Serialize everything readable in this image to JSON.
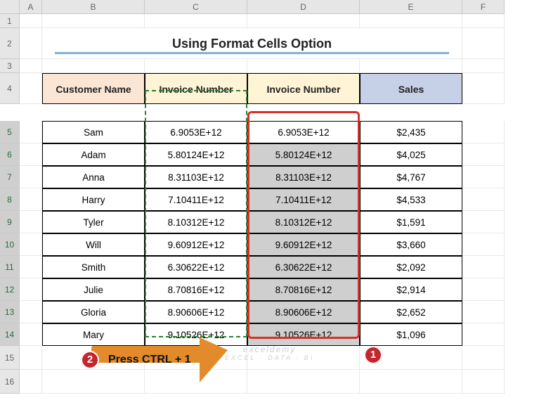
{
  "columns": [
    "A",
    "B",
    "C",
    "D",
    "E",
    "F"
  ],
  "rows": [
    "1",
    "2",
    "3",
    "4",
    "5",
    "6",
    "7",
    "8",
    "9",
    "10",
    "11",
    "12",
    "13",
    "14",
    "15",
    "16"
  ],
  "title": "Using Format Cells Option",
  "headers": {
    "b": "Customer Name",
    "c": "Invoice Number",
    "d": "Invoice Number",
    "e": "Sales"
  },
  "data": [
    {
      "name": "Sam",
      "c": "6.9053E+12",
      "d": "6.9053E+12",
      "sales": "$2,435"
    },
    {
      "name": "Adam",
      "c": "5.80124E+12",
      "d": "5.80124E+12",
      "sales": "$4,025"
    },
    {
      "name": "Anna",
      "c": "8.31103E+12",
      "d": "8.31103E+12",
      "sales": "$4,767"
    },
    {
      "name": "Harry",
      "c": "7.10411E+12",
      "d": "7.10411E+12",
      "sales": "$4,533"
    },
    {
      "name": "Tyler",
      "c": "8.10312E+12",
      "d": "8.10312E+12",
      "sales": "$1,591"
    },
    {
      "name": "Will",
      "c": "9.60912E+12",
      "d": "9.60912E+12",
      "sales": "$3,660"
    },
    {
      "name": "Smith",
      "c": "6.30622E+12",
      "d": "6.30622E+12",
      "sales": "$2,092"
    },
    {
      "name": "Julie",
      "c": "8.70816E+12",
      "d": "8.70816E+12",
      "sales": "$2,914"
    },
    {
      "name": "Gloria",
      "c": "8.90606E+12",
      "d": "8.90606E+12",
      "sales": "$2,652"
    },
    {
      "name": "Mary",
      "c": "9.10526E+12",
      "d": "9.10526E+12",
      "sales": "$1,096"
    }
  ],
  "callout": {
    "text": "Press CTRL + 1",
    "badge1": "1",
    "badge2": "2"
  },
  "watermark": {
    "line1": "exceldemy",
    "line2": "EXCEL · DATA · BI"
  },
  "chart_data": {
    "type": "table",
    "title": "Using Format Cells Option",
    "columns": [
      "Customer Name",
      "Invoice Number",
      "Invoice Number",
      "Sales"
    ],
    "rows": [
      [
        "Sam",
        "6.9053E+12",
        "6.9053E+12",
        2435
      ],
      [
        "Adam",
        "5.80124E+12",
        "5.80124E+12",
        4025
      ],
      [
        "Anna",
        "8.31103E+12",
        "8.31103E+12",
        4767
      ],
      [
        "Harry",
        "7.10411E+12",
        "7.10411E+12",
        4533
      ],
      [
        "Tyler",
        "8.10312E+12",
        "8.10312E+12",
        1591
      ],
      [
        "Will",
        "9.60912E+12",
        "9.60912E+12",
        3660
      ],
      [
        "Smith",
        "6.30622E+12",
        "6.30622E+12",
        2092
      ],
      [
        "Julie",
        "8.70816E+12",
        "8.70816E+12",
        2914
      ],
      [
        "Gloria",
        "8.90606E+12",
        "8.90606E+12",
        2652
      ],
      [
        "Mary",
        "9.10526E+12",
        "9.10526E+12",
        1096
      ]
    ]
  }
}
